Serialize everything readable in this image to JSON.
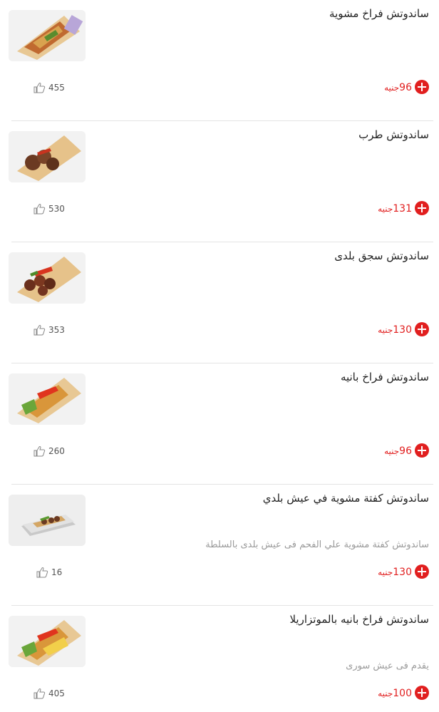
{
  "menu_items": [
    {
      "title": "ساندوتش فراخ مشوية",
      "description": "",
      "price": "96",
      "currency": "جنيه",
      "likes": "455",
      "image": "grilled-chicken-wrap"
    },
    {
      "title": "ساندوتش طرب",
      "description": "",
      "price": "131",
      "currency": "جنيه",
      "likes": "530",
      "image": "tarab-wrap"
    },
    {
      "title": "ساندوتش سجق بلدى",
      "description": "",
      "price": "130",
      "currency": "جنيه",
      "likes": "353",
      "image": "sausage-wrap"
    },
    {
      "title": "ساندوتش فراخ بانيه",
      "description": "",
      "price": "96",
      "currency": "جنيه",
      "likes": "260",
      "image": "chicken-pane-wrap"
    },
    {
      "title": "ساندوتش كفتة مشوية في عيش بلدي",
      "description": "ساندوتش كفتة مشوية علي الفحم فى عيش بلدى بالسلطة",
      "price": "130",
      "currency": "جنيه",
      "likes": "16",
      "image": "kofta-baladi-sandwich"
    },
    {
      "title": "ساندوتش فراخ بانيه بالموتزاريلا",
      "description": "يقدم فى عيش سورى",
      "price": "100",
      "currency": "جنيه",
      "likes": "405",
      "image": "chicken-pane-mozzarella-wrap"
    }
  ],
  "colors": {
    "accent": "#e11f1f",
    "divider": "#e4e4e4",
    "muted_text": "#9a9a9a"
  },
  "icons": {
    "add": "plus-circle-icon",
    "like": "thumbs-up-icon"
  }
}
